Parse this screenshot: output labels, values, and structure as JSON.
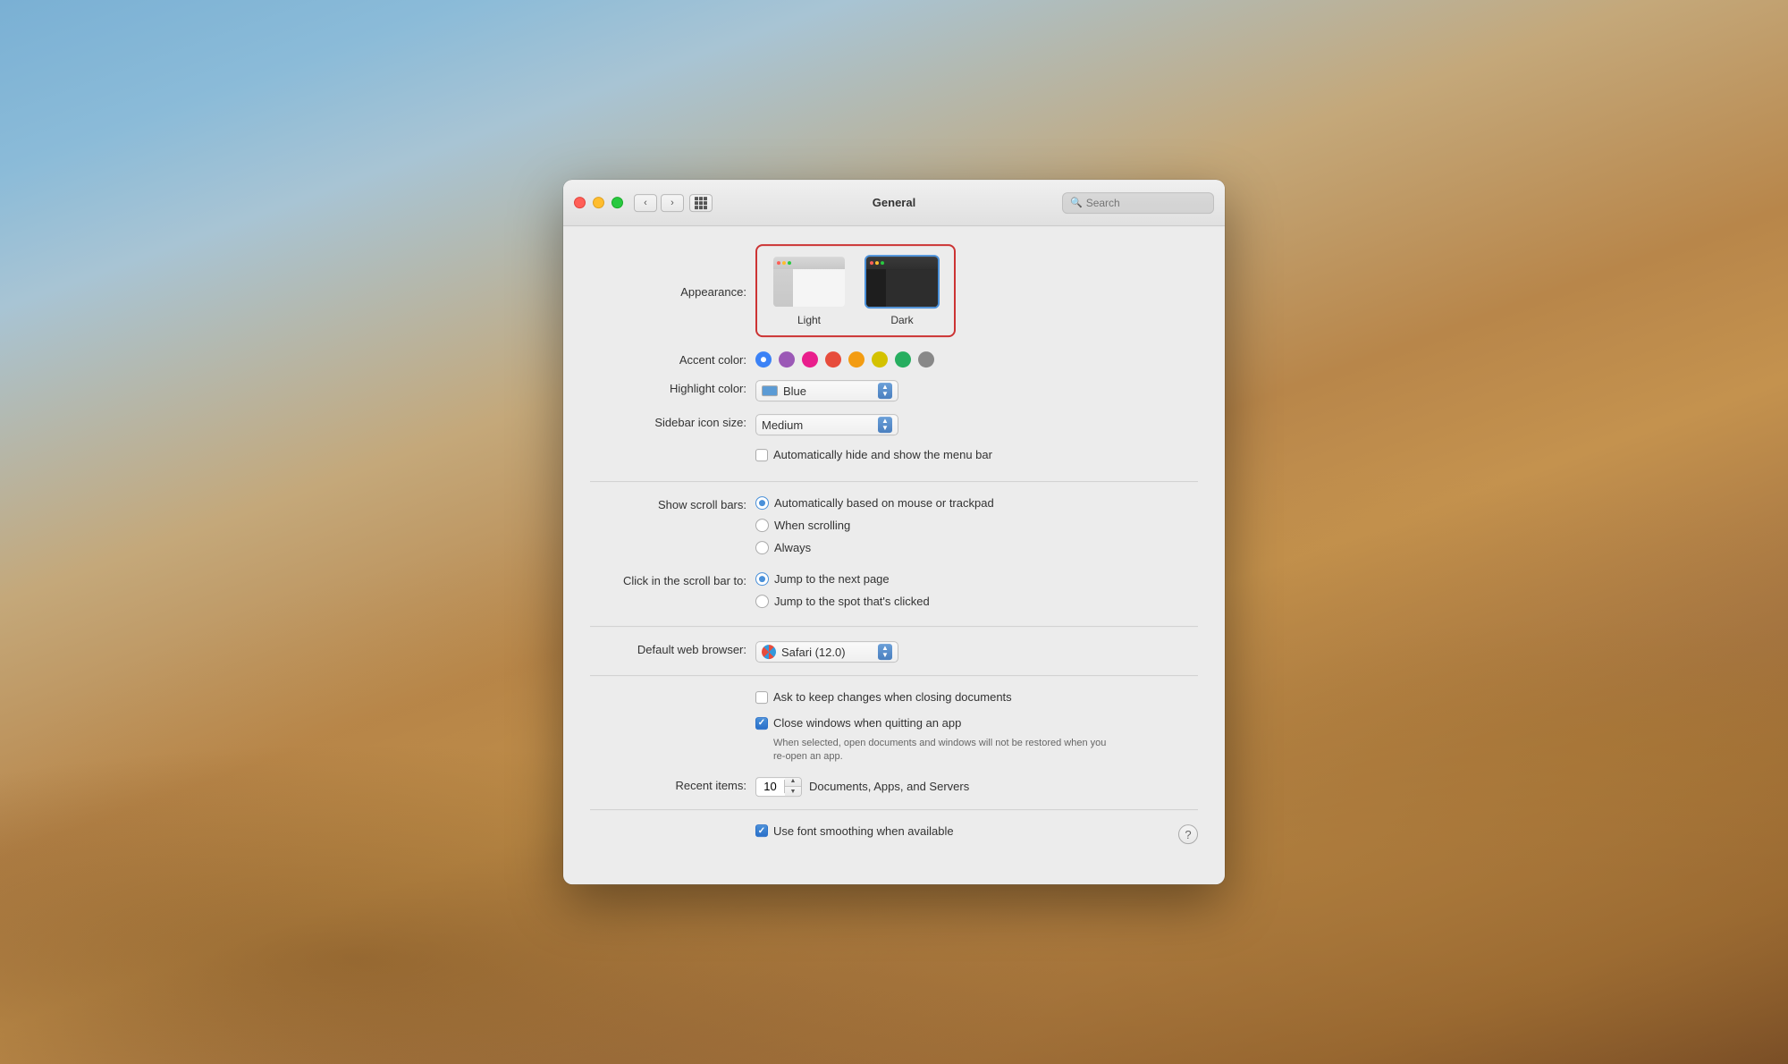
{
  "desktop": {
    "bg_description": "macOS Mojave desert landscape"
  },
  "window": {
    "title": "General",
    "search_placeholder": "Search",
    "search_value": ""
  },
  "titlebar": {
    "back_label": "‹",
    "forward_label": "›"
  },
  "appearance": {
    "label": "Appearance:",
    "options": [
      {
        "id": "light",
        "name": "Light",
        "selected": false
      },
      {
        "id": "dark",
        "name": "Dark",
        "selected": true
      }
    ]
  },
  "accent_color": {
    "label": "Accent color:",
    "colors": [
      {
        "id": "blue",
        "hex": "#3b82f6",
        "selected": true
      },
      {
        "id": "purple",
        "hex": "#9b59b6",
        "selected": false
      },
      {
        "id": "pink",
        "hex": "#e91e8c",
        "selected": false
      },
      {
        "id": "red",
        "hex": "#e74c3c",
        "selected": false
      },
      {
        "id": "orange",
        "hex": "#f39c12",
        "selected": false
      },
      {
        "id": "yellow",
        "hex": "#d4c200",
        "selected": false
      },
      {
        "id": "green",
        "hex": "#27ae60",
        "selected": false
      },
      {
        "id": "graphite",
        "hex": "#888888",
        "selected": false
      }
    ]
  },
  "highlight_color": {
    "label": "Highlight color:",
    "value": "Blue",
    "swatch": "#5b9bd5"
  },
  "sidebar_icon_size": {
    "label": "Sidebar icon size:",
    "value": "Medium"
  },
  "menu_bar": {
    "label": "",
    "checkbox_label": "Automatically hide and show the menu bar",
    "checked": false
  },
  "scroll_bars": {
    "label": "Show scroll bars:",
    "options": [
      {
        "id": "auto",
        "label": "Automatically based on mouse or trackpad",
        "selected": true
      },
      {
        "id": "scrolling",
        "label": "When scrolling",
        "selected": false
      },
      {
        "id": "always",
        "label": "Always",
        "selected": false
      }
    ]
  },
  "scroll_bar_click": {
    "label": "Click in the scroll bar to:",
    "options": [
      {
        "id": "next_page",
        "label": "Jump to the next page",
        "selected": true
      },
      {
        "id": "spot",
        "label": "Jump to the spot that's clicked",
        "selected": false
      }
    ]
  },
  "default_browser": {
    "label": "Default web browser:",
    "value": "Safari (12.0)"
  },
  "documents": {
    "ask_changes_label": "Ask to keep changes when closing documents",
    "ask_changes_checked": false,
    "close_windows_label": "Close windows when quitting an app",
    "close_windows_checked": true,
    "close_windows_note": "When selected, open documents and windows will not be restored when you re-open an app."
  },
  "recent_items": {
    "label": "Recent items:",
    "value": "10",
    "suffix": "Documents, Apps, and Servers"
  },
  "font_smoothing": {
    "label": "Use font smoothing when available",
    "checked": true
  }
}
